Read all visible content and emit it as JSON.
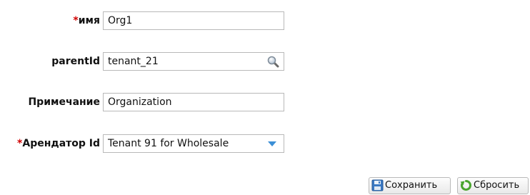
{
  "form": {
    "name_field": {
      "required_marker": "*",
      "label": "имя",
      "value": "Org1"
    },
    "parent_field": {
      "label": "parentId",
      "value": "tenant_21",
      "icon": "search-icon"
    },
    "note_field": {
      "label": "Примечание",
      "value": "Organization"
    },
    "tenant_field": {
      "required_marker": "*",
      "label": "Арендатор Id",
      "value": "Tenant 91 for Wholesale",
      "icon": "chevron-down-icon"
    }
  },
  "actions": {
    "save_label": "Сохранить",
    "save_icon": "save-icon",
    "reset_label": "Сбросить",
    "reset_icon": "reset-icon"
  },
  "colors": {
    "required": "#d00000",
    "dropdown_arrow": "#3b8fd6"
  }
}
